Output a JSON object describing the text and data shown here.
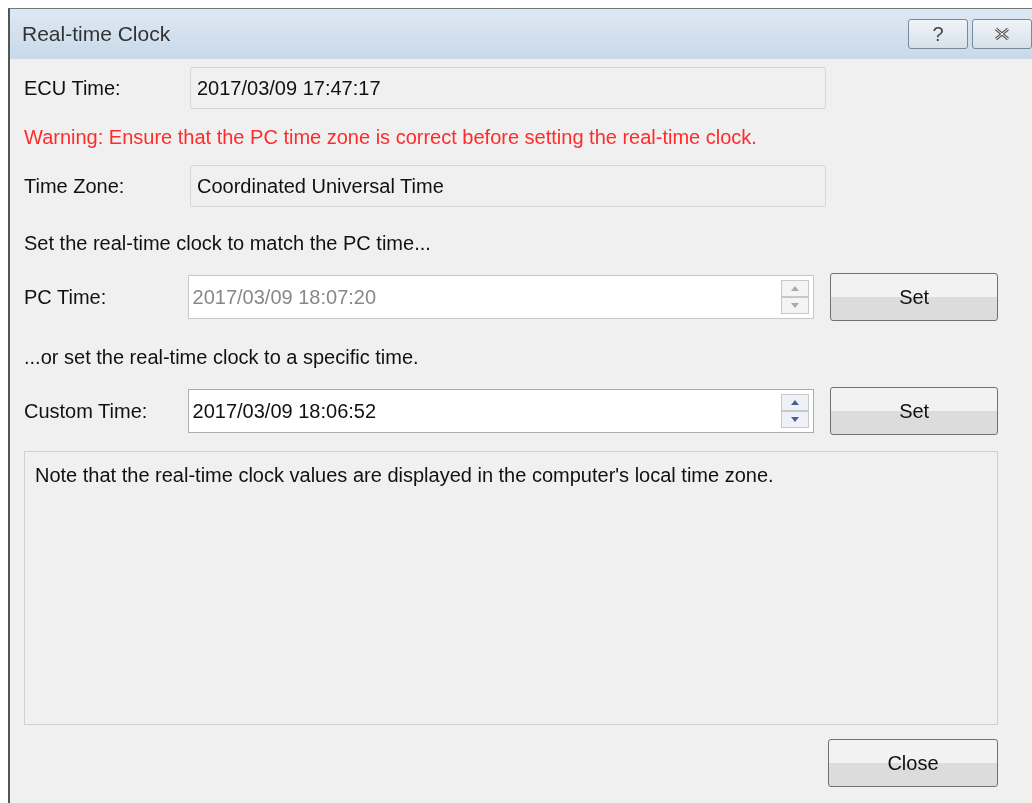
{
  "window": {
    "title": "Real-time Clock",
    "help_button": "?"
  },
  "rows": [
    {
      "kind": "readonly",
      "label": "ECU Time:",
      "value": "2017/03/09 17:47:17"
    },
    {
      "kind": "warning",
      "text": "Warning: Ensure that the PC time zone is correct before setting the real-time clock."
    },
    {
      "kind": "readonly",
      "label": "Time Zone:",
      "value": "Coordinated Universal Time"
    },
    {
      "kind": "text",
      "text": "Set the real-time clock to match the PC time..."
    },
    {
      "kind": "spin",
      "label": "PC Time:",
      "value": "2017/03/09 18:07:20",
      "disabled": true,
      "button": "Set"
    },
    {
      "kind": "text",
      "text": "...or set the real-time clock to a specific time."
    },
    {
      "kind": "spin",
      "label": "Custom Time:",
      "value": "2017/03/09 18:06:52",
      "disabled": false,
      "button": "Set"
    }
  ],
  "note": "Note that the real-time clock values are displayed in the computer's local time zone.",
  "close_button": "Close"
}
